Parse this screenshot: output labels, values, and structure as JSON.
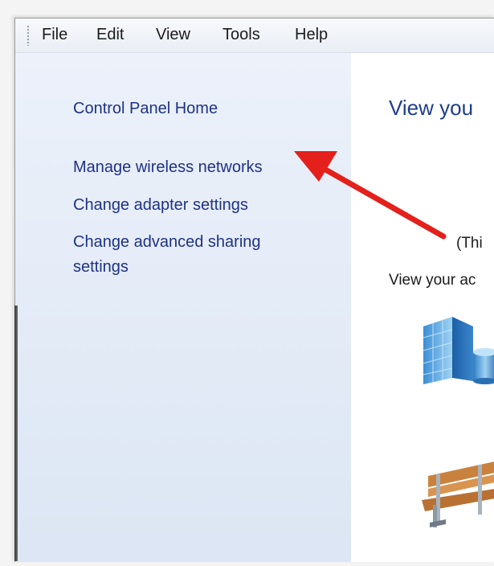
{
  "menu": {
    "items": [
      "File",
      "Edit",
      "View",
      "Tools",
      "Help"
    ]
  },
  "sidebar": {
    "home": "Control Panel Home",
    "links": [
      "Manage wireless networks",
      "Change adapter settings",
      "Change advanced sharing settings"
    ]
  },
  "main": {
    "title": "View you",
    "paren_text": "(Thi",
    "sub_text": "View your ac"
  },
  "annotation": {
    "arrow_color": "#e3201b"
  },
  "icons": {
    "network": "building-network-icon",
    "bench": "park-bench-icon"
  }
}
